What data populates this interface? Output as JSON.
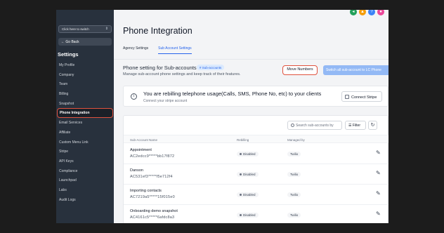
{
  "sidebar": {
    "switcher_label": "Click here to switch",
    "go_back": "Go Back",
    "heading": "Settings",
    "items": [
      {
        "label": "My Profile"
      },
      {
        "label": "Company"
      },
      {
        "label": "Team"
      },
      {
        "label": "Billing"
      },
      {
        "label": "Snapshot"
      },
      {
        "label": "Phone Integration",
        "active": true
      },
      {
        "label": "Email Services"
      },
      {
        "label": "Affiliate"
      },
      {
        "label": "Custom Menu Link"
      },
      {
        "label": "Stripe"
      },
      {
        "label": "API Keys"
      },
      {
        "label": "Compliance"
      },
      {
        "label": "Launchpad"
      },
      {
        "label": "Labs"
      },
      {
        "label": "Audit Logs"
      }
    ]
  },
  "header_icons": [
    {
      "name": "megaphone-icon",
      "color": "#22a05a"
    },
    {
      "name": "bell-icon",
      "color": "#f59e0b"
    },
    {
      "name": "help-icon",
      "color": "#3b82f6"
    },
    {
      "name": "avatar-icon",
      "color": "#ec4899"
    }
  ],
  "page": {
    "title": "Phone Integration",
    "tabs": [
      {
        "label": "Agency Settings",
        "active": false
      },
      {
        "label": "Sub Account Settings",
        "active": true
      }
    ]
  },
  "section": {
    "title": "Phone setting for Sub-accounts",
    "badge": "# Sub-accounts",
    "description": "Manage sub-account phone settings and keep track of their features.",
    "move_numbers": "Move Numbers",
    "switch_all": "Switch all sub-account to LC Phone"
  },
  "rebilling": {
    "title": "You are rebilling telephone usage(Calls, SMS, Phone No, etc) to your clients",
    "subtitle": "Connect your stripe account",
    "connect_stripe": "Connect Stripe"
  },
  "table": {
    "search_placeholder": "Search sub-accounts by",
    "filter_label": "Filter",
    "columns": {
      "name": "Sub-Account Name",
      "rebilling": "Rebilling",
      "managed": "Managed by"
    },
    "rows": [
      {
        "name": "Appointment",
        "id": "AC2edcc9*****bb17f872",
        "rebilling": "Disabled",
        "managed": "Twilio"
      },
      {
        "name": "Danson",
        "id": "AC531ef3*****f5e712f4",
        "rebilling": "Disabled",
        "managed": "Twilio"
      },
      {
        "name": "Importing contacts",
        "id": "AC7219a5*****15f015e0",
        "rebilling": "Disabled",
        "managed": "Twilio"
      },
      {
        "name": "Onboarding demo snapshot",
        "id": "AC4161c5*****6afdc8a3",
        "rebilling": "Disabled",
        "managed": "Twilio"
      }
    ]
  }
}
